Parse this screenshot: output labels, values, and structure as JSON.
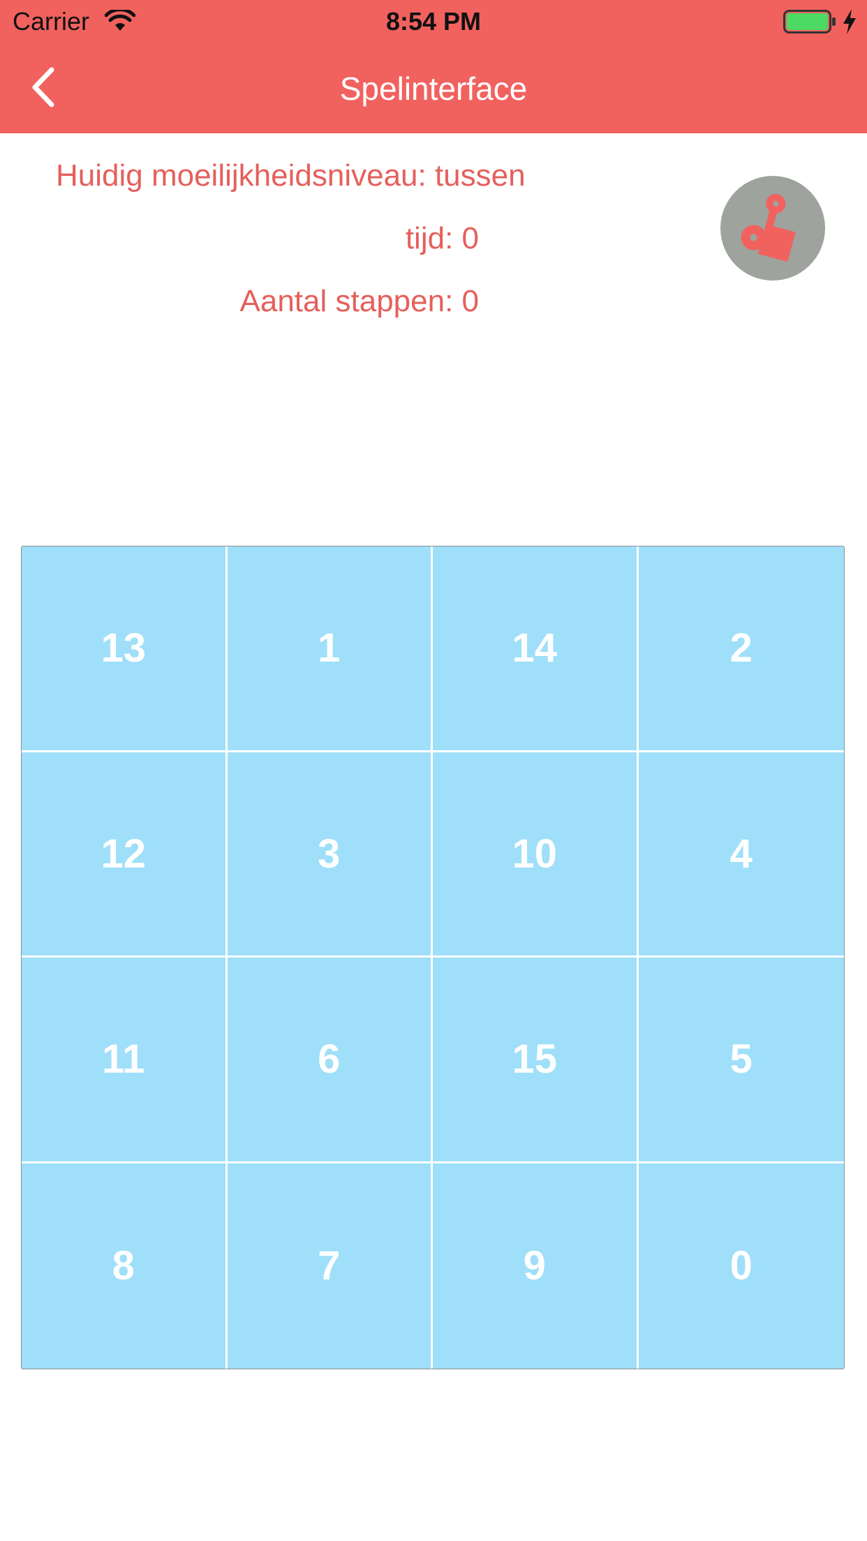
{
  "status_bar": {
    "carrier": "Carrier",
    "time": "8:54 PM",
    "battery_color": "#4cd964"
  },
  "nav": {
    "title": "Spelinterface",
    "back_icon": "chevron-left-icon",
    "background": "#f1625f"
  },
  "info": {
    "difficulty": "Huidig moeilijkheidsniveau: tussen",
    "time": "tijd: 0",
    "steps": "Aantal stappen: 0",
    "text_color": "#e4605c"
  },
  "sound_button": {
    "icon": "music-note-icon"
  },
  "board": {
    "tile_color": "#9fdff9",
    "tiles": [
      "13",
      "1",
      "14",
      "2",
      "12",
      "3",
      "10",
      "4",
      "11",
      "6",
      "15",
      "5",
      "8",
      "7",
      "9",
      "0"
    ]
  }
}
